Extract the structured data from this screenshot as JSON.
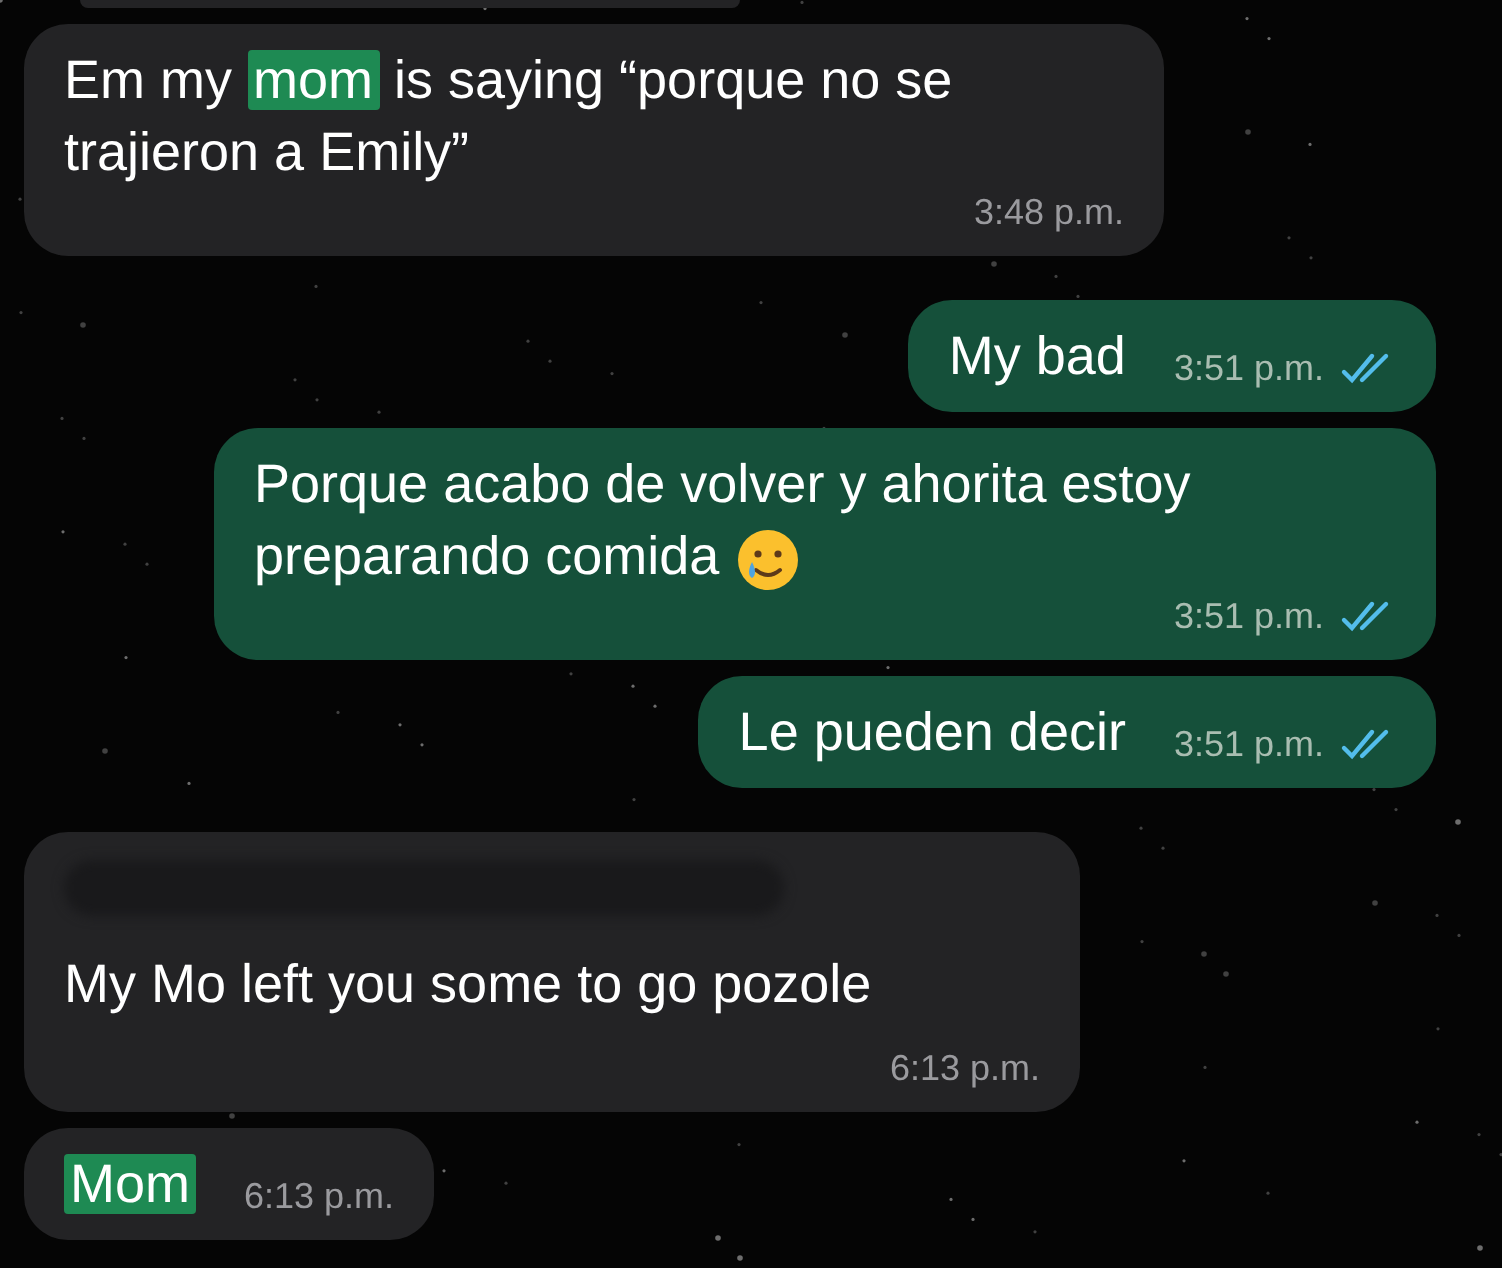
{
  "messages": [
    {
      "outgoing": false,
      "kind": "wrapped",
      "segments": [
        {
          "text": "Em my ",
          "highlighted": false
        },
        {
          "text": "mom",
          "highlighted": true
        },
        {
          "text": " is saying “porque no se trajieron a Emily”",
          "highlighted": false
        }
      ],
      "time": "3:48 p.m."
    },
    {
      "outgoing": true,
      "kind": "single",
      "segments": [
        {
          "text": "My bad",
          "highlighted": false
        }
      ],
      "time": "3:51 p.m.",
      "read": true
    },
    {
      "outgoing": true,
      "kind": "wrapped",
      "segments": [
        {
          "text": "Porque acabo de volver y ahorita estoy preparando comida",
          "highlighted": false
        }
      ],
      "time": "3:51 p.m.",
      "read": true,
      "has_emoji": true
    },
    {
      "outgoing": true,
      "kind": "single",
      "segments": [
        {
          "text": "Le pueden decir",
          "highlighted": false
        }
      ],
      "time": "3:51 p.m.",
      "read": true
    },
    {
      "outgoing": false,
      "kind": "stacked",
      "segments": [
        {
          "text": "My Mo left you some to go pozole",
          "highlighted": false
        }
      ],
      "time": "6:13 p.m.",
      "redacted_reply": true
    },
    {
      "outgoing": false,
      "kind": "single",
      "segments": [
        {
          "text": "Mom",
          "highlighted": true
        }
      ],
      "time": "6:13 p.m."
    }
  ]
}
